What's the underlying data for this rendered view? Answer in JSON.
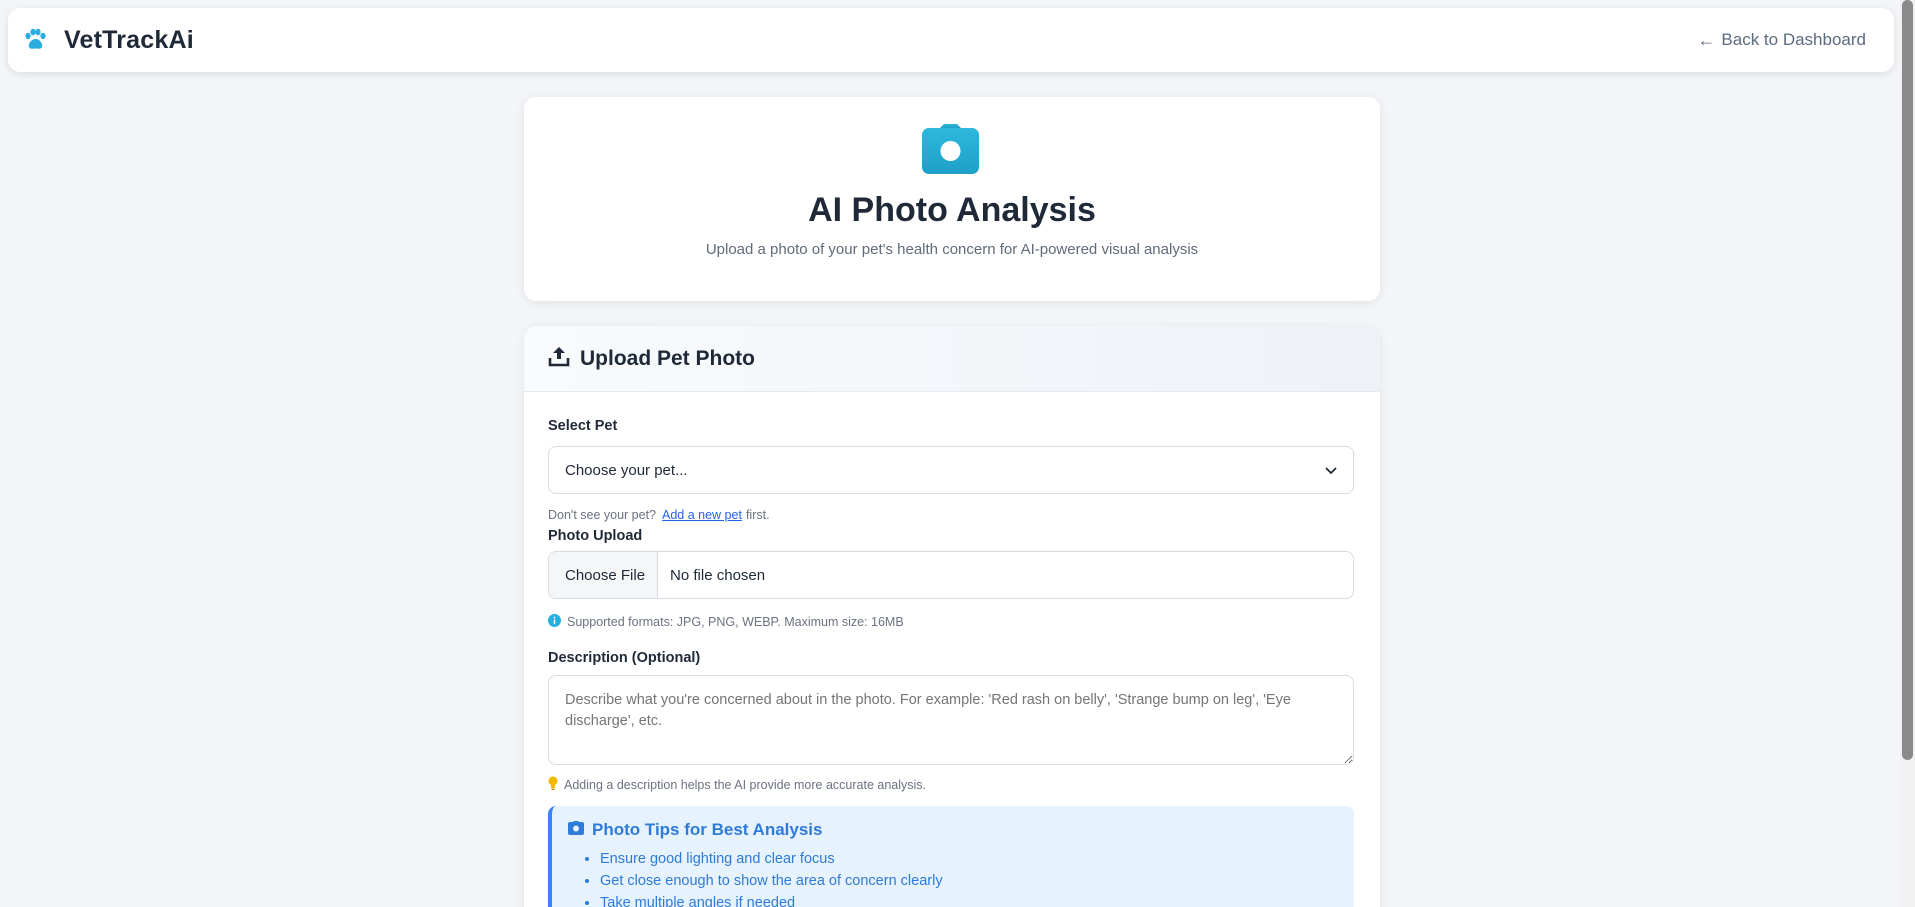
{
  "app": {
    "name": "VetTrackAi",
    "back_label": "Back to Dashboard"
  },
  "hero": {
    "title": "AI Photo Analysis",
    "subtitle": "Upload a photo of your pet's health concern for AI-powered visual analysis"
  },
  "upload": {
    "header": "Upload Pet Photo",
    "select_pet": {
      "label": "Select Pet",
      "value": "Choose your pet...",
      "hint_prefix": "Don't see your pet?",
      "hint_link": "Add a new pet",
      "hint_suffix": "first."
    },
    "photo": {
      "label": "Photo Upload",
      "button_label": "Choose File",
      "status": "No file chosen",
      "hint": "Supported formats: JPG, PNG, WEBP. Maximum size: 16MB"
    },
    "description": {
      "label": "Description (Optional)",
      "placeholder": "Describe what you're concerned about in the photo. For example: 'Red rash on belly', 'Strange bump on leg', 'Eye discharge', etc.",
      "hint": "Adding a description helps the AI provide more accurate analysis."
    },
    "tips": {
      "title": "Photo Tips for Best Analysis",
      "items": [
        "Ensure good lighting and clear focus",
        "Get close enough to show the area of concern clearly",
        "Take multiple angles if needed"
      ]
    }
  },
  "colors": {
    "brand": "#2aaee0",
    "tips_accent": "#3b82f6"
  }
}
